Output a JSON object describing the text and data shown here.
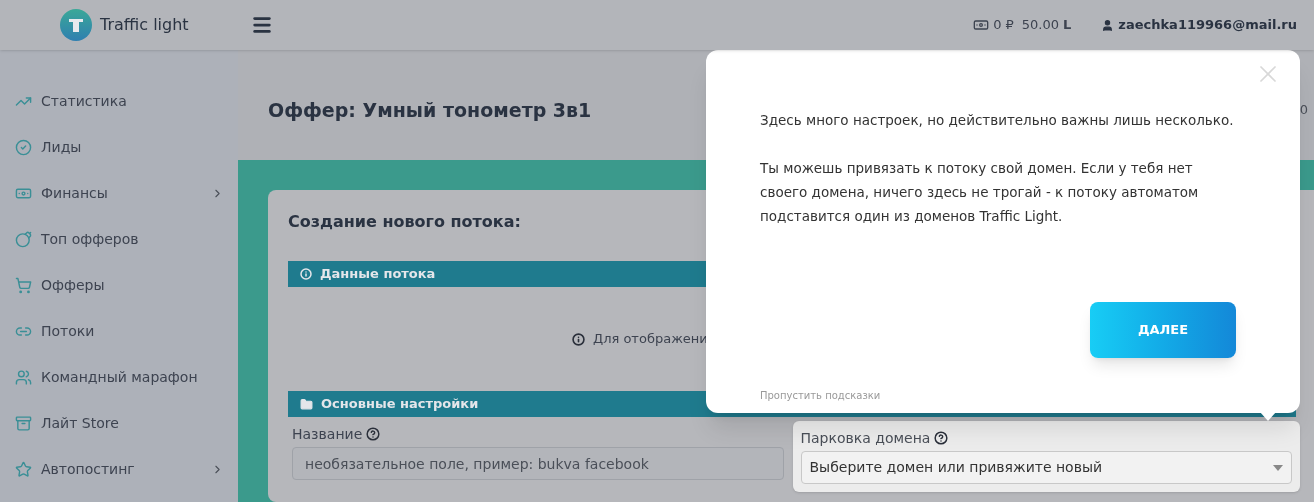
{
  "header": {
    "logo_text": "Traffic light",
    "balance_rub": "0 ₽",
    "balance_leads": "50.00",
    "leads_sign": "L",
    "user_email": "zaechka119966@mail.ru"
  },
  "sidebar": {
    "items": [
      {
        "label": "Статистика",
        "has_submenu": false
      },
      {
        "label": "Лиды",
        "has_submenu": false
      },
      {
        "label": "Финансы",
        "has_submenu": true
      },
      {
        "label": "Топ офферов",
        "has_submenu": false
      },
      {
        "label": "Офферы",
        "has_submenu": false
      },
      {
        "label": "Потоки",
        "has_submenu": false
      },
      {
        "label": "Командный марафон",
        "has_submenu": false
      },
      {
        "label": "Лайт Store",
        "has_submenu": false
      },
      {
        "label": "Автопостинг",
        "has_submenu": true
      }
    ]
  },
  "page": {
    "title": "Оффер: Умный тонометр 3в1",
    "side_text": "0"
  },
  "card": {
    "title": "Создание нового потока:",
    "sections": [
      {
        "title": "Данные потока",
        "kind": "info"
      },
      {
        "title": "Основные настройки",
        "kind": "folder"
      }
    ],
    "info_text": "Для отображени",
    "fields": [
      {
        "kind": "input",
        "label": "Название",
        "placeholder": "необязательное поле, пример: bukva facebook",
        "highlighted": false
      },
      {
        "kind": "select",
        "label": "Парковка домена",
        "value": "Выберите домен или привяжите новый",
        "highlighted": true
      }
    ]
  },
  "tour": {
    "paragraphs": [
      "Здесь много настроек, но действительно важны лишь несколько.",
      "Ты можешь привязать к потоку свой домен. Если у тебя нет своего домена, ничего здесь не трогай - к потоку автоматом подставится один из доменов Traffic Light."
    ],
    "button": "ДАЛЕЕ",
    "skip_link": "Пропустить подсказки"
  }
}
